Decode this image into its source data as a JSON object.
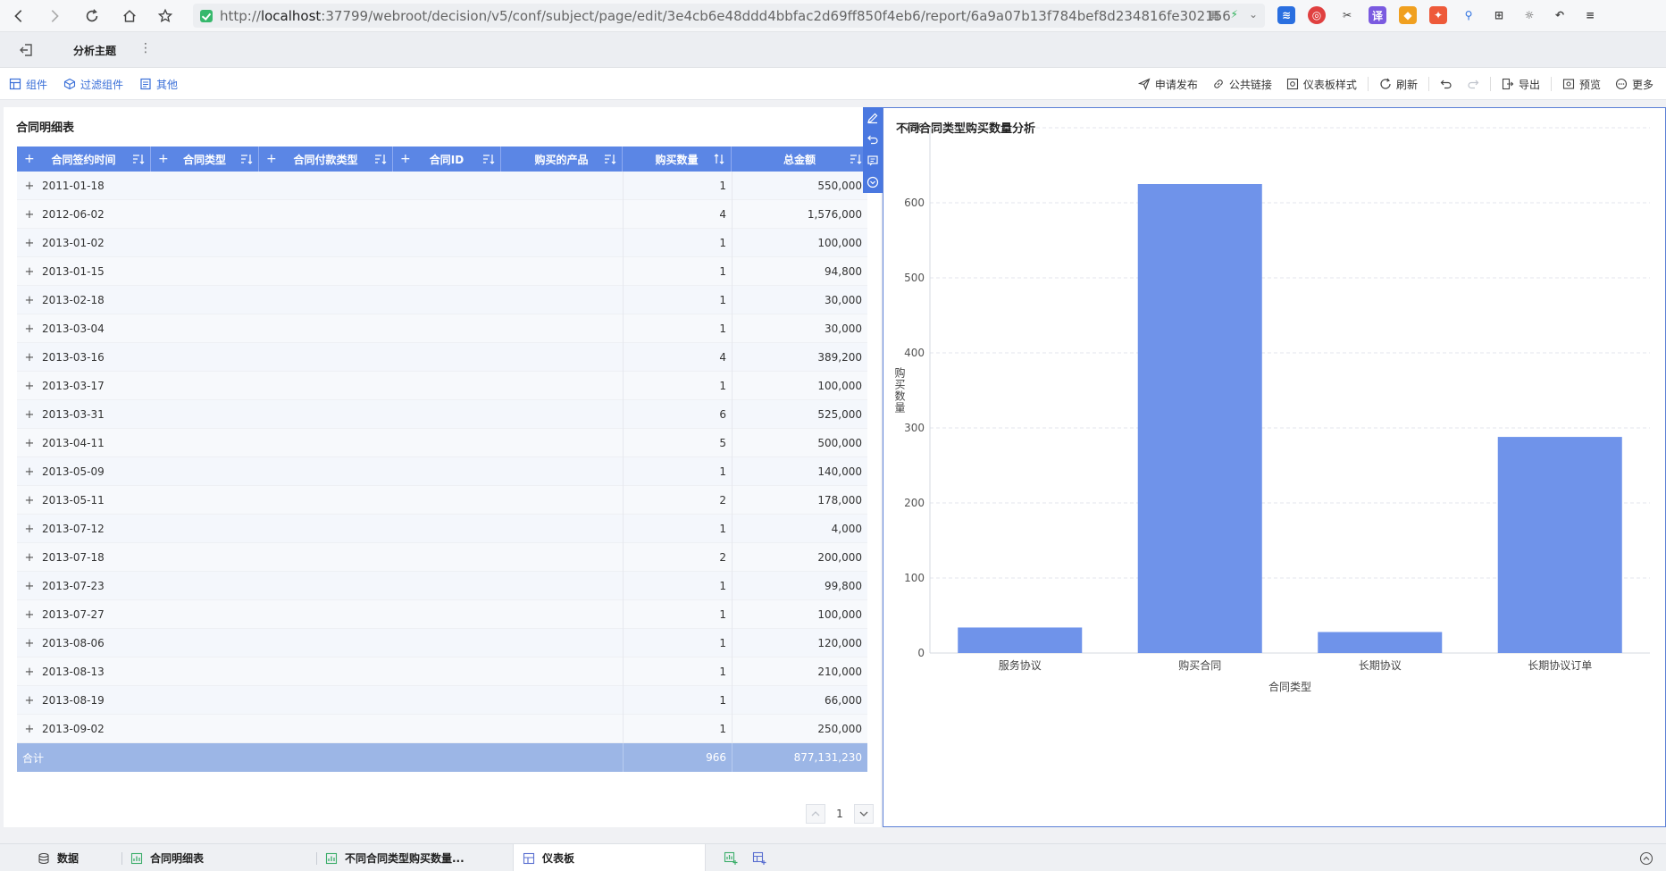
{
  "browser": {
    "url_prefix": "http://",
    "url_host": "localhost",
    "url_rest": ":37799/webroot/decision/v5/conf/subject/page/edit/3e4cb6e48ddd4bbfac2d69ff850f4eb6/report/6a9a07b13f784bef8d234816fe302156"
  },
  "app": {
    "tab_title": "分析主题",
    "tab_more": "⋮"
  },
  "toolbar": {
    "left": [
      "组件",
      "过滤组件",
      "其他"
    ],
    "publish": "申请发布",
    "public_link": "公共链接",
    "dashboard_style": "仪表板样式",
    "refresh": "刷新",
    "export": "导出",
    "preview": "预览",
    "more": "更多"
  },
  "table": {
    "title": "合同明细表",
    "columns": [
      "合同签约时间",
      "合同类型",
      "合同付款类型",
      "合同ID",
      "购买的产品",
      "购买数量",
      "总金额"
    ],
    "rows": [
      [
        "2011-01-18",
        "1",
        "550,000"
      ],
      [
        "2012-06-02",
        "4",
        "1,576,000"
      ],
      [
        "2013-01-02",
        "1",
        "100,000"
      ],
      [
        "2013-01-15",
        "1",
        "94,800"
      ],
      [
        "2013-02-18",
        "1",
        "30,000"
      ],
      [
        "2013-03-04",
        "1",
        "30,000"
      ],
      [
        "2013-03-16",
        "4",
        "389,200"
      ],
      [
        "2013-03-17",
        "1",
        "100,000"
      ],
      [
        "2013-03-31",
        "6",
        "525,000"
      ],
      [
        "2013-04-11",
        "5",
        "500,000"
      ],
      [
        "2013-05-09",
        "1",
        "140,000"
      ],
      [
        "2013-05-11",
        "2",
        "178,000"
      ],
      [
        "2013-07-12",
        "1",
        "4,000"
      ],
      [
        "2013-07-18",
        "2",
        "200,000"
      ],
      [
        "2013-07-23",
        "1",
        "99,800"
      ],
      [
        "2013-07-27",
        "1",
        "100,000"
      ],
      [
        "2013-08-06",
        "1",
        "120,000"
      ],
      [
        "2013-08-13",
        "1",
        "210,000"
      ],
      [
        "2013-08-19",
        "1",
        "66,000"
      ],
      [
        "2013-09-02",
        "1",
        "250,000"
      ]
    ],
    "total_label": "合计",
    "total_qty": "966",
    "total_amount": "877,131,230",
    "page": "1"
  },
  "chart_data": {
    "type": "bar",
    "title": "不同合同类型购买数量分析",
    "categories": [
      "服务协议",
      "购买合同",
      "长期协议",
      "长期协议订单"
    ],
    "values": [
      34,
      625,
      28,
      288
    ],
    "xlabel": "合同类型",
    "ylabel": "购买数量",
    "ylim": [
      0,
      700
    ],
    "yticks": [
      "0",
      "100",
      "200",
      "300",
      "400",
      "500",
      "600",
      "700"
    ],
    "grid": true,
    "bar_color": "#6f93ea"
  },
  "bottom": {
    "data_tab": "数据",
    "table_tab": "合同明细表",
    "chart_tab": "不同合同类型购买数量...",
    "dashboard_tab": "仪表板"
  }
}
